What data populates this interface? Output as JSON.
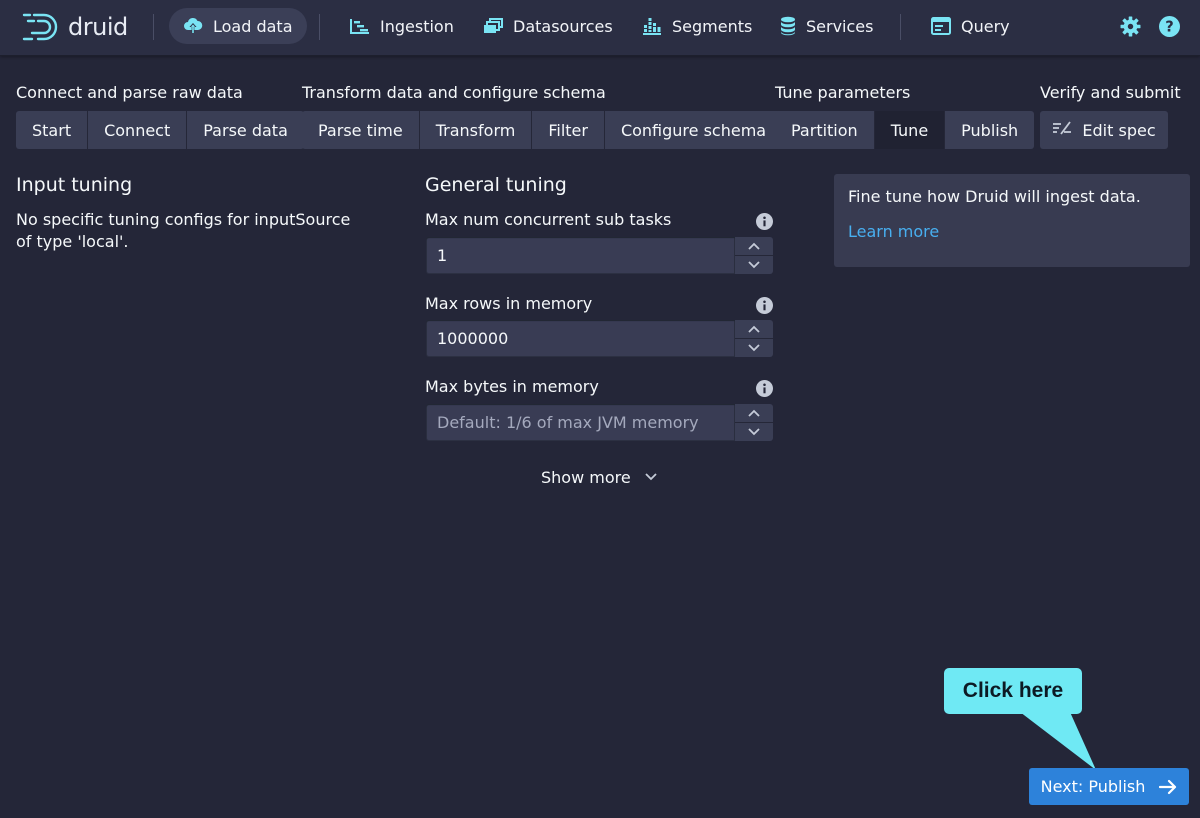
{
  "app": {
    "logo_text": "druid"
  },
  "nav": {
    "load_data": "Load data",
    "ingestion": "Ingestion",
    "datasources": "Datasources",
    "segments": "Segments",
    "services": "Services",
    "query": "Query"
  },
  "steps": {
    "group1": {
      "label": "Connect and parse raw data",
      "buttons": [
        "Start",
        "Connect",
        "Parse data"
      ]
    },
    "group2": {
      "label": "Transform data and configure schema",
      "buttons": [
        "Parse time",
        "Transform",
        "Filter",
        "Configure schema"
      ]
    },
    "group3": {
      "label": "Tune parameters",
      "buttons": [
        "Partition",
        "Tune",
        "Publish"
      ]
    },
    "group4": {
      "label": "Verify and submit",
      "buttons": [
        "Edit spec"
      ]
    }
  },
  "input_tuning": {
    "title": "Input tuning",
    "description": "No specific tuning configs for inputSource of type 'local'."
  },
  "general_tuning": {
    "title": "General tuning",
    "fields": [
      {
        "label": "Max num concurrent sub tasks",
        "value": "1",
        "placeholder": ""
      },
      {
        "label": "Max rows in memory",
        "value": "1000000",
        "placeholder": ""
      },
      {
        "label": "Max bytes in memory",
        "value": "",
        "placeholder": "Default: 1/6 of max JVM memory"
      }
    ],
    "show_more": "Show more"
  },
  "callout": {
    "text": "Fine tune how Druid will ingest data.",
    "link": "Learn more"
  },
  "next_button": "Next: Publish",
  "tooltip": "Click here",
  "colors": {
    "background": "#242638",
    "nav": "#2b2e43",
    "accent": "#2d82da",
    "link": "#48aff0",
    "icon": "#7ae4f4",
    "tooltip": "#6fe9f4"
  }
}
